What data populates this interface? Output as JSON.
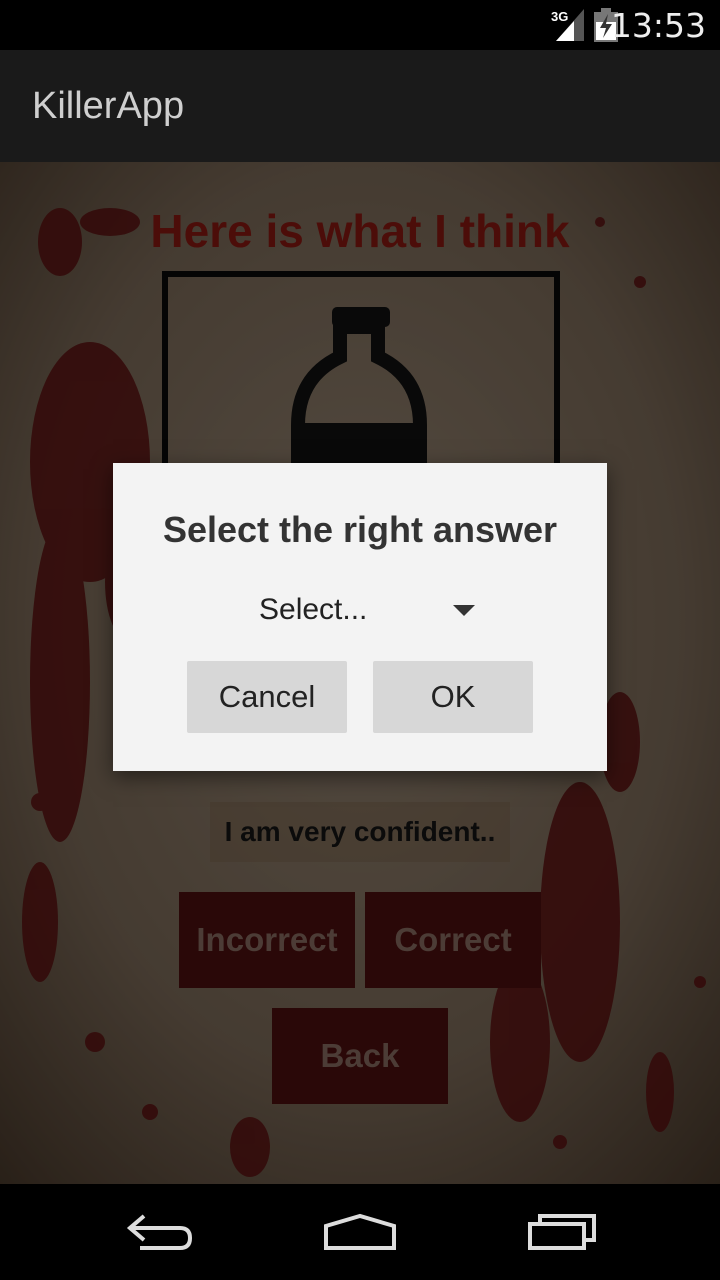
{
  "status_bar": {
    "network": "3G",
    "time": "13:53"
  },
  "app": {
    "title": "KillerApp"
  },
  "content": {
    "headline": "Here is what I think",
    "image_icon": "bottle-icon",
    "confidence_text": "I am very confident..",
    "incorrect_label": "Incorrect",
    "correct_label": "Correct",
    "back_label": "Back"
  },
  "dialog": {
    "title": "Select the right answer",
    "spinner_value": "Select...",
    "cancel_label": "Cancel",
    "ok_label": "OK"
  },
  "colors": {
    "accent_red": "#8a1812",
    "button_red": "#4e0f0f",
    "dialog_bg": "#f3f3f3"
  },
  "nav_bar": {
    "icons": [
      "back-icon",
      "home-icon",
      "recent-apps-icon"
    ]
  }
}
